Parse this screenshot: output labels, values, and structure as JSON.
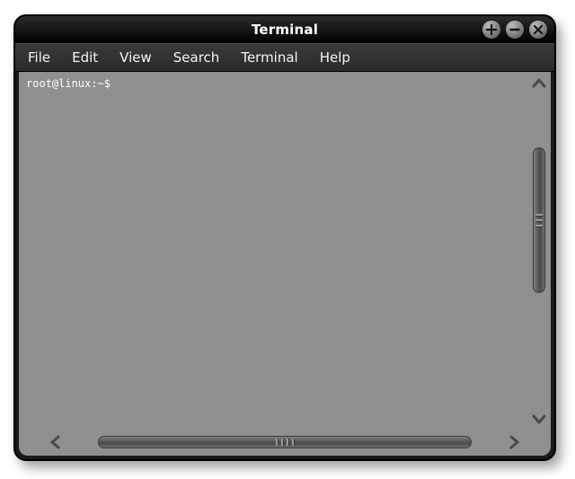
{
  "window": {
    "title": "Terminal"
  },
  "menubar": {
    "items": [
      {
        "label": "File"
      },
      {
        "label": "Edit"
      },
      {
        "label": "View"
      },
      {
        "label": "Search"
      },
      {
        "label": "Terminal"
      },
      {
        "label": "Help"
      }
    ]
  },
  "terminal": {
    "prompt": "root@linux:~$ "
  },
  "icons": {
    "add": "add-icon",
    "minimize": "minimize-icon",
    "close": "close-icon"
  }
}
